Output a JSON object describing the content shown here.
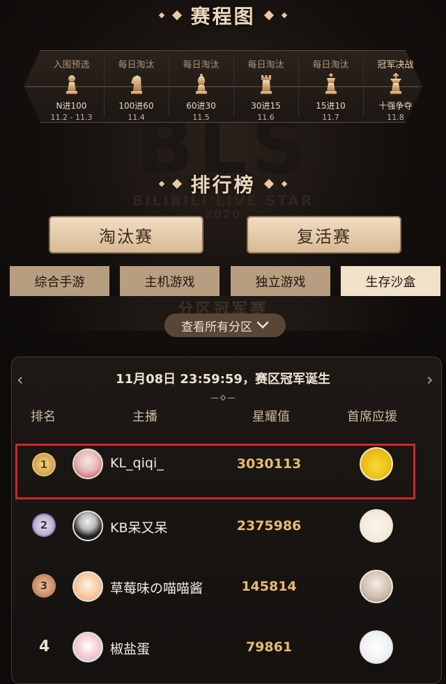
{
  "schedule": {
    "title": "赛程图",
    "stages": [
      {
        "name": "入围预选",
        "label": "N进100",
        "date": "11.2 - 11.3",
        "icon": "pawn-icon"
      },
      {
        "name": "每日淘汰",
        "label": "100进60",
        "date": "11.4",
        "icon": "knight-icon"
      },
      {
        "name": "每日淘汰",
        "label": "60进30",
        "date": "11.5",
        "icon": "bishop-icon"
      },
      {
        "name": "每日淘汰",
        "label": "30进15",
        "date": "11.6",
        "icon": "rook-icon"
      },
      {
        "name": "每日淘汰",
        "label": "15进10",
        "date": "11.7",
        "icon": "queen-icon"
      },
      {
        "name": "冠军决战",
        "label": "十强争夺",
        "date": "11.8",
        "icon": "king-icon"
      }
    ]
  },
  "ranking": {
    "title": "排行榜",
    "watermark": "BILIBILI LIVE STAR",
    "watermark_year": "2020",
    "mode_tabs": [
      "淘汰赛",
      "复活赛"
    ],
    "category_tabs": [
      "综合手游",
      "主机游戏",
      "独立游戏",
      "生存沙盒"
    ],
    "active_category": "生存沙盒",
    "region_banner": "分区冠军赛",
    "view_all": "查看所有分区"
  },
  "leaderboard": {
    "header": "11月08日 23:59:59，赛区冠军诞生",
    "columns": [
      "排名",
      "主播",
      "星耀值",
      "首席应援"
    ],
    "rows": [
      {
        "rank": "1",
        "name": "KL_qiqi_",
        "score": "3030113",
        "medal": "gold"
      },
      {
        "rank": "2",
        "name": "KB呆又呆",
        "score": "2375986",
        "medal": "silver"
      },
      {
        "rank": "3",
        "name": "草莓味の喵喵酱",
        "score": "145814",
        "medal": "bronze"
      },
      {
        "rank": "4",
        "name": "椒盐蛋",
        "score": "79861",
        "medal": "none"
      }
    ]
  },
  "colors": {
    "accent_gold": "#e7bb72",
    "highlight_border": "#d1262a",
    "tab_light": "#f1e1c8",
    "tab_dark": "#b89e80"
  }
}
